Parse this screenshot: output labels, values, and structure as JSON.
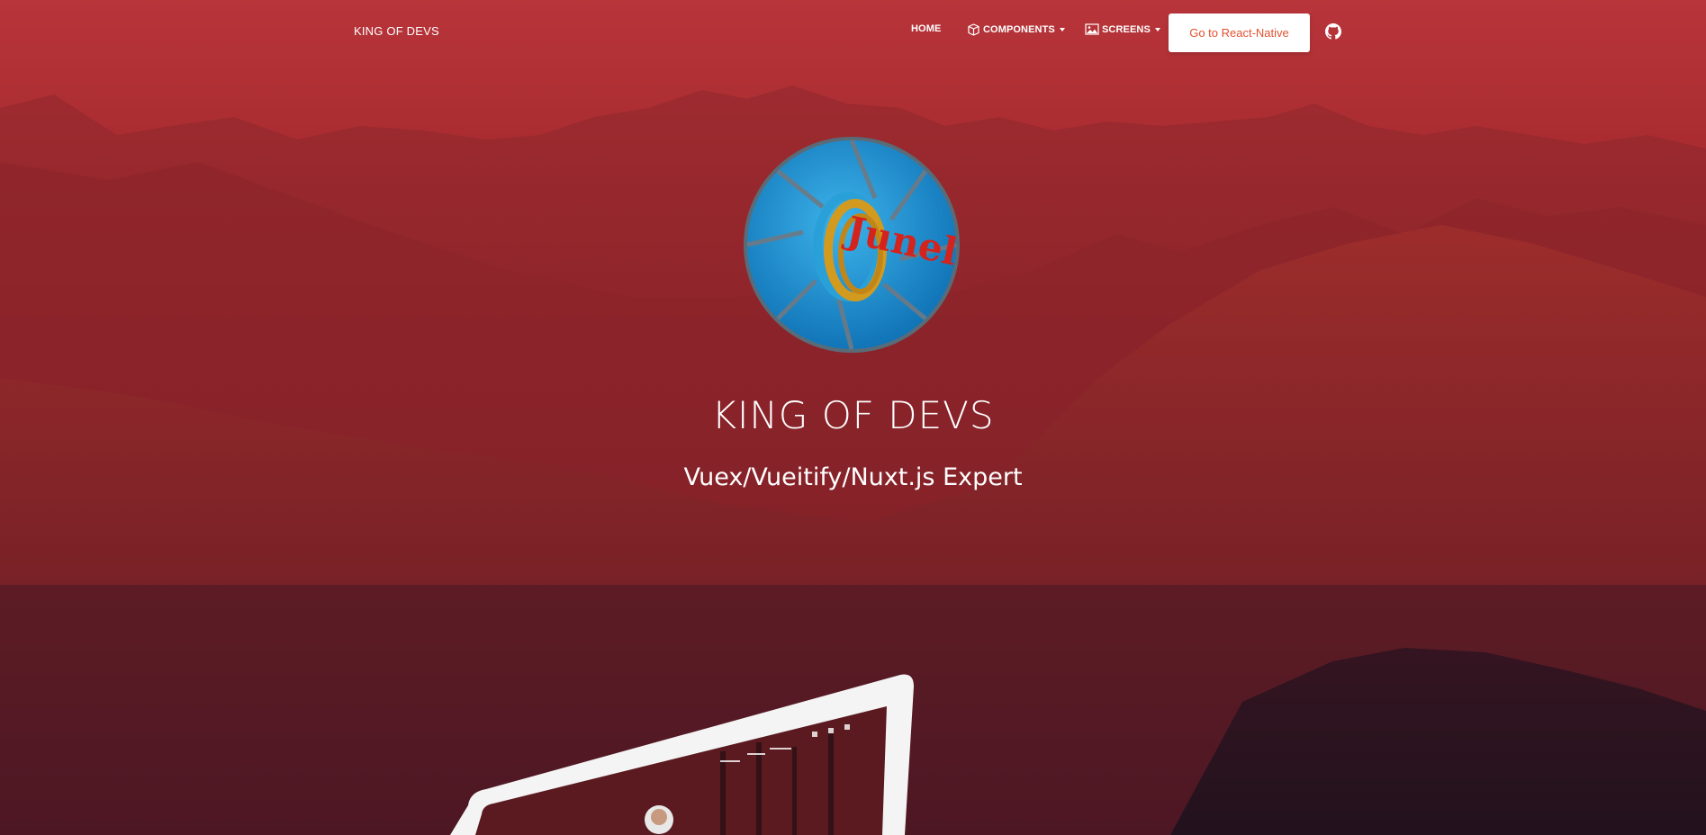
{
  "navbar": {
    "brand": "KING OF DEVS",
    "items": [
      {
        "label": "HOME",
        "icon": null
      },
      {
        "label": "COMPONENTS",
        "icon": "cube-icon"
      },
      {
        "label": "SCREENS",
        "icon": "image-icon"
      }
    ],
    "cta_label": "Go to React-Native",
    "github_icon": "github-icon"
  },
  "hero": {
    "title": "KING OF DEVS",
    "subtitle": "Vuex/Vueitify/Nuxt.js Expert",
    "logo_text": "Junel"
  },
  "colors": {
    "accent": "#e25230",
    "overlay_top": "#b8353a",
    "overlay_bottom": "#2d1626",
    "logo_blue": "#1b93d6"
  }
}
